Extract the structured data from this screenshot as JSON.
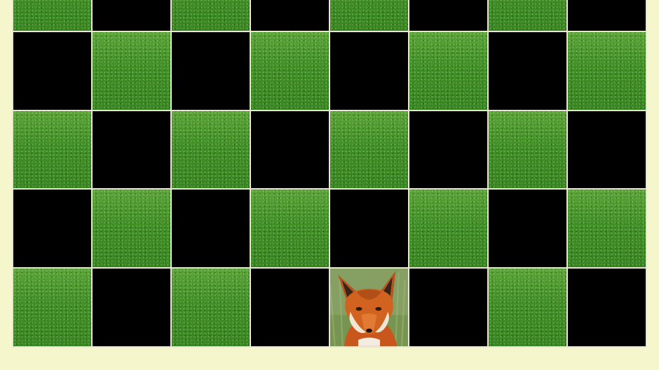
{
  "colors": {
    "background": "#f6f6cc",
    "grid_line": "#e8e8d0",
    "black_cell": "#000000",
    "grass": "#3f8f22"
  },
  "board": {
    "columns": 8,
    "rows": 5,
    "cells": [
      [
        "grass",
        "black",
        "grass",
        "black",
        "grass",
        "black",
        "grass",
        "black"
      ],
      [
        "black",
        "grass",
        "black",
        "grass",
        "black",
        "grass",
        "black",
        "grass"
      ],
      [
        "grass",
        "black",
        "grass",
        "black",
        "grass",
        "black",
        "grass",
        "black"
      ],
      [
        "black",
        "grass",
        "black",
        "grass",
        "black",
        "grass",
        "black",
        "grass"
      ],
      [
        "grass",
        "black",
        "grass",
        "black",
        "fox",
        "black",
        "grass",
        "black"
      ]
    ]
  }
}
